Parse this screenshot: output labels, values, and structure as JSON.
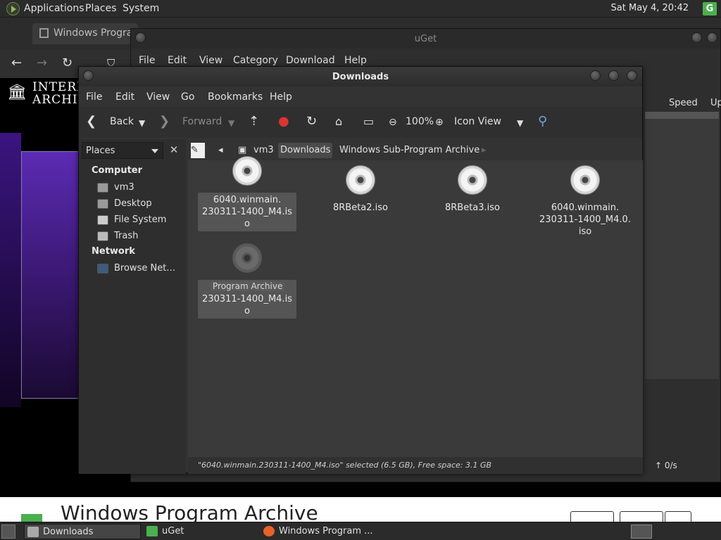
{
  "top_panel": {
    "menus": [
      "Applications",
      "Places",
      "System"
    ],
    "clock": "Sat May  4, 20:42",
    "tray_icon": "uget-tray-icon"
  },
  "browser": {
    "tab_title": "Windows Program",
    "ia_logo_text": [
      "INTERN",
      "ARCHIV"
    ],
    "page_title": "Windows Program Archive"
  },
  "uget": {
    "title": "uGet",
    "menus": [
      "File",
      "Edit",
      "View",
      "Category",
      "Download",
      "Help"
    ],
    "column_speed": "Speed",
    "column_up": "Up",
    "status_rate": "↑  0/s"
  },
  "file_manager": {
    "title": "Downloads",
    "menus": [
      "File",
      "Edit",
      "View",
      "Go",
      "Bookmarks",
      "Help"
    ],
    "toolbar": {
      "back": "Back",
      "forward": "Forward",
      "zoom": "100%",
      "view_mode": "Icon View"
    },
    "sidebar": {
      "places_label": "Places",
      "computer_heading": "Computer",
      "computer_items": [
        "vm3",
        "Desktop",
        "File System",
        "Trash"
      ],
      "network_heading": "Network",
      "network_items": [
        "Browse Net…"
      ]
    },
    "pathbar": [
      "vm3",
      "Downloads",
      "Windows Sub-Program Archive"
    ],
    "files": [
      {
        "name": "6040.winmain.\n230311-1400_M4.iso",
        "selected": true,
        "dragging": true
      },
      {
        "name": "8RBeta2.iso",
        "selected": false
      },
      {
        "name": "8RBeta3.iso",
        "selected": false
      },
      {
        "name": "6040.winmain.\n230311-1400_M4.0.\niso",
        "selected": false
      },
      {
        "name": "6040.winmain.\n230311-1400_M4.iso",
        "selected": true,
        "dim": true
      }
    ],
    "drop_hint": "Program Archive",
    "status": "\"6040.winmain.230311-1400_M4.iso\" selected (6.5 GB), Free space: 3.1 GB"
  },
  "taskbar": {
    "tasks": [
      "Downloads",
      "uGet",
      "Windows Program ..."
    ]
  }
}
